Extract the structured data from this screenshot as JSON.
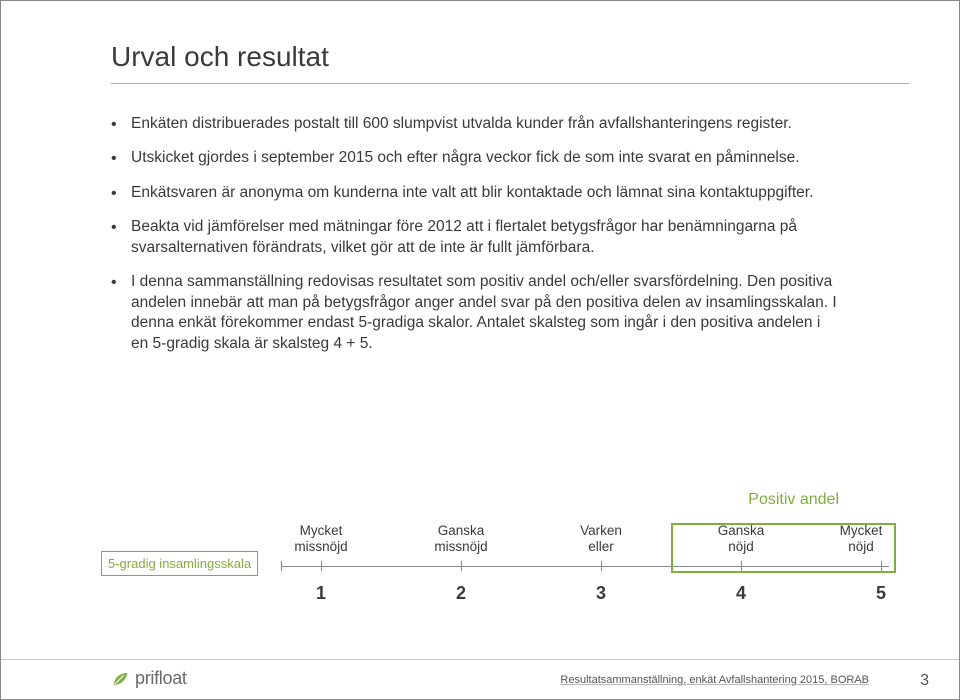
{
  "title": "Urval och resultat",
  "bullets": [
    "Enkäten distribuerades postalt till 600 slumpvist utvalda kunder från avfallshanteringens register.",
    "Utskicket gjordes i september 2015 och efter några veckor fick de som inte svarat en påminnelse.",
    "Enkätsvaren är anonyma om kunderna inte valt att blir kontaktade och lämnat sina kontaktuppgifter.",
    "Beakta vid jämförelser med mätningar före 2012 att i flertalet betygsfrågor har  benämningarna på svarsalternativen förändrats, vilket gör att de inte är fullt jämförbara.",
    "I denna sammanställning redovisas resultatet som positiv andel och/eller svarsfördelning. Den positiva andelen innebär att man på betygsfrågor anger andel svar på den positiva delen av insamlingsskalan. I denna enkät förekommer endast 5-gradiga skalor. Antalet skalsteg som ingår i den positiva andelen i en 5-gradig skala är skalsteg 4 + 5."
  ],
  "positive_label": "Positiv andel",
  "scale_key": "5-gradig insamlingsskala",
  "scale": {
    "labels": [
      {
        "line1": "Mycket",
        "line2": "missnöjd"
      },
      {
        "line1": "Ganska",
        "line2": "missnöjd"
      },
      {
        "line1": "Varken",
        "line2": "eller"
      },
      {
        "line1": "Ganska",
        "line2": "nöjd"
      },
      {
        "line1": "Mycket",
        "line2": "nöjd"
      }
    ],
    "numbers": [
      "1",
      "2",
      "3",
      "4",
      "5"
    ]
  },
  "chart_data": {
    "type": "table",
    "title": "5-gradig insamlingsskala",
    "categories": [
      "Mycket missnöjd",
      "Ganska missnöjd",
      "Varken eller",
      "Ganska nöjd",
      "Mycket nöjd"
    ],
    "values": [
      1,
      2,
      3,
      4,
      5
    ],
    "positive_steps": [
      4,
      5
    ],
    "positive_label": "Positiv andel"
  },
  "footer": {
    "logo_text": "prifloat",
    "text": "Resultatsammanställning, enkät Avfallshantering 2015, BORAB",
    "page": "3"
  }
}
